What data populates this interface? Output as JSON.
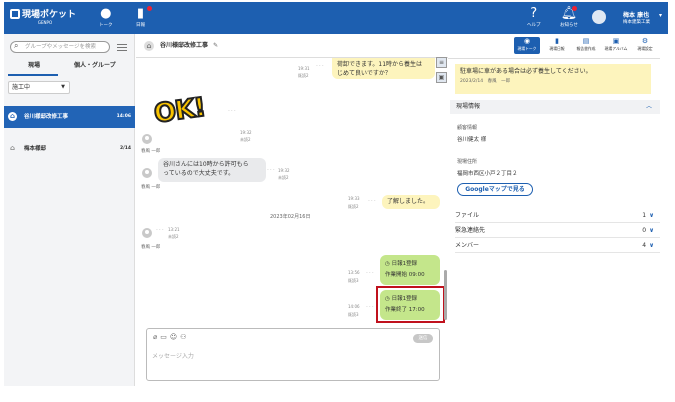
{
  "app": {
    "name": "現場ポケット",
    "sub": "GENPO"
  },
  "topnav": {
    "talk": "トーク",
    "nippo": "日報",
    "help": "ヘルプ",
    "notice": "お知らせ",
    "user_name": "梅本 康也",
    "user_org": "梅本建築工業"
  },
  "sidebar": {
    "search_placeholder": "グループやメッセージを検索",
    "tabs": [
      "現場",
      "個人・グループ"
    ],
    "filter_value": "施工中",
    "rooms": [
      {
        "name": "谷川様邸改修工事",
        "time": "14:06"
      },
      {
        "name": "梅本様邸",
        "time": "2/14"
      }
    ]
  },
  "chat": {
    "title": "谷川様邸改修工事",
    "msgs": {
      "m1_text_1": "荷卸できます。11時から養生は",
      "m1_text_2": "じめて良いですか？",
      "m1_time": "19:31",
      "m1_read": "既読2",
      "ok_sticker": "OK!",
      "ok_time": "19:32",
      "ok_read": "未読2",
      "sender": "春風 一郎",
      "m2_text_1": "谷川さんには10時から許可もら",
      "m2_text_2": "っているので大丈夫です。",
      "m2_time": "19:32",
      "m2_read": "未読2",
      "m3_text": "了解しました。",
      "m3_time": "19:33",
      "m3_read": "既読2",
      "date": "2023年02月16日",
      "m4_time": "13:21",
      "m4_read": "未読2",
      "r1_title": "日報1登録",
      "r1_body": "作業開始 09:00",
      "r1_time": "13:56",
      "r1_read": "既読3",
      "r2_title": "日報1登録",
      "r2_body": "作業終了 17:00",
      "r2_time": "14:06",
      "r2_read": "既読3"
    },
    "composer_placeholder": "メッセージ入力",
    "send": "送信"
  },
  "right": {
    "tabs": [
      "現場トーク",
      "現場日報",
      "報告書作成",
      "現場アルバム",
      "現場設定"
    ],
    "notice_text": "駐車場に車がある場合は必ず養生してください。",
    "notice_meta": "2023/2/14　春風　一郎",
    "info_header": "現場情報",
    "client_label": "顧客情報",
    "client_value": "谷川健太 様",
    "address_label": "現場住所",
    "address_value": "福岡市西区小戸２丁目２",
    "map_button": "Googleマップで見る",
    "rows": [
      {
        "label": "ファイル",
        "count": "1"
      },
      {
        "label": "緊急連絡先",
        "count": "0"
      },
      {
        "label": "メンバー",
        "count": "4"
      }
    ]
  },
  "colors": {
    "brand": "#1d5fb0",
    "green_bubble": "#c4e68b",
    "yellow_bubble": "#fdf4bd",
    "highlight": "#c0111d"
  }
}
